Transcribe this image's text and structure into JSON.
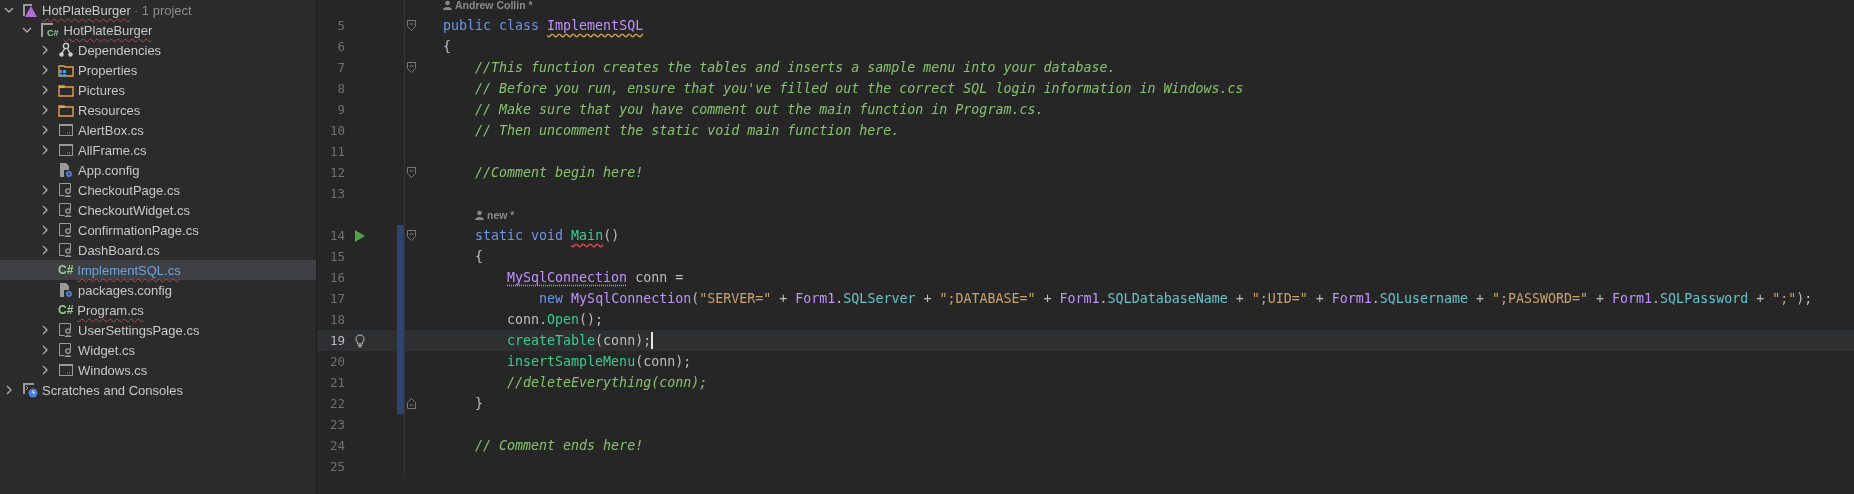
{
  "sidebar": {
    "items": [
      {
        "label": "HotPlateBurger",
        "note": "· 1 project",
        "kind": "solution",
        "squiggle": true,
        "expanded": true,
        "selected": false,
        "children": [
          {
            "label": "HotPlateBurger",
            "kind": "project",
            "badge": "C#",
            "squiggle": true,
            "expanded": true,
            "selected": false,
            "children": [
              {
                "label": "Dependencies",
                "kind": "dependencies",
                "squiggle": false,
                "expanded": false,
                "selected": false
              },
              {
                "label": "Properties",
                "kind": "properties",
                "squiggle": false,
                "expanded": false,
                "selected": false
              },
              {
                "label": "Pictures",
                "kind": "folder",
                "squiggle": false,
                "expanded": false,
                "selected": false
              },
              {
                "label": "Resources",
                "kind": "folder",
                "squiggle": false,
                "expanded": false,
                "selected": false
              },
              {
                "label": "AlertBox.cs",
                "kind": "form",
                "squiggle": false,
                "expanded": false,
                "selected": false
              },
              {
                "label": "AllFrame.cs",
                "kind": "form",
                "squiggle": false,
                "expanded": false,
                "selected": false
              },
              {
                "label": "App.config",
                "kind": "config",
                "leaf": true,
                "squiggle": false,
                "expanded": false,
                "selected": false
              },
              {
                "label": "CheckoutPage.cs",
                "kind": "usercontrol",
                "squiggle": false,
                "expanded": false,
                "selected": false
              },
              {
                "label": "CheckoutWidget.cs",
                "kind": "usercontrol",
                "squiggle": false,
                "expanded": false,
                "selected": false
              },
              {
                "label": "ConfirmationPage.cs",
                "kind": "usercontrol",
                "squiggle": false,
                "expanded": false,
                "selected": false
              },
              {
                "label": "DashBoard.cs",
                "kind": "usercontrol",
                "squiggle": false,
                "expanded": false,
                "selected": false
              },
              {
                "label": "ImplementSQL.cs",
                "kind": "csharp",
                "badge": "C#",
                "leaf": true,
                "squiggle": true,
                "expanded": false,
                "selected": true
              },
              {
                "label": "packages.config",
                "kind": "config",
                "leaf": true,
                "squiggle": false,
                "expanded": false,
                "selected": false
              },
              {
                "label": "Program.cs",
                "kind": "csharp",
                "badge": "C#",
                "leaf": true,
                "squiggle": true,
                "expanded": false,
                "selected": false
              },
              {
                "label": "UserSettingsPage.cs",
                "kind": "usercontrol",
                "squiggle": false,
                "expanded": false,
                "selected": false
              },
              {
                "label": "Widget.cs",
                "kind": "usercontrol",
                "squiggle": false,
                "expanded": false,
                "selected": false
              },
              {
                "label": "Windows.cs",
                "kind": "form",
                "squiggle": false,
                "expanded": false,
                "selected": false
              }
            ]
          }
        ]
      },
      {
        "label": "Scratches and Consoles",
        "kind": "scratches",
        "squiggle": false,
        "expanded": false,
        "selected": false
      }
    ]
  },
  "editor": {
    "lines": [
      {
        "kind": "hint",
        "text": "Andrew Collin *"
      },
      {
        "kind": "code",
        "number": "5",
        "fold": {
          "kind": "start"
        },
        "changed": false,
        "current": false,
        "tokens": [
          {
            "text": "public class ",
            "kind": "keyword"
          },
          {
            "text": "ImplementSQL",
            "kind": "type",
            "squiggle": {
              "kind": "warning"
            }
          }
        ]
      },
      {
        "kind": "code",
        "number": "6",
        "changed": false,
        "current": false,
        "tokens": [
          {
            "text": "{",
            "kind": "plain"
          }
        ]
      },
      {
        "kind": "code",
        "number": "7",
        "fold": {
          "kind": "start"
        },
        "changed": false,
        "current": false,
        "tokens": [
          {
            "text": "    //This function creates the tables and inserts a sample menu into your database.",
            "kind": "comment"
          }
        ]
      },
      {
        "kind": "code",
        "number": "8",
        "changed": false,
        "current": false,
        "tokens": [
          {
            "text": "    // Before you run, ensure that you've filled out the correct SQL login information in Windows.cs",
            "kind": "comment"
          }
        ]
      },
      {
        "kind": "code",
        "number": "9",
        "changed": false,
        "current": false,
        "tokens": [
          {
            "text": "    // Make sure that you have comment out the main function in Program.cs.",
            "kind": "comment"
          }
        ]
      },
      {
        "kind": "code",
        "number": "10",
        "changed": false,
        "current": false,
        "tokens": [
          {
            "text": "    // Then uncomment the static void main function here.",
            "kind": "comment"
          }
        ]
      },
      {
        "kind": "code",
        "number": "11",
        "changed": false,
        "current": false
      },
      {
        "kind": "code",
        "number": "12",
        "fold": {
          "kind": "start"
        },
        "changed": false,
        "current": false,
        "tokens": [
          {
            "text": "    //Comment begin here!",
            "kind": "comment"
          }
        ]
      },
      {
        "kind": "code",
        "number": "13",
        "changed": false,
        "current": false
      },
      {
        "kind": "hint",
        "text": "    new *"
      },
      {
        "kind": "code",
        "number": "14",
        "gutter": {
          "kind": "run"
        },
        "fold": {
          "kind": "start"
        },
        "changed": true,
        "current": false,
        "tokens": [
          {
            "text": "    static void ",
            "kind": "keyword"
          },
          {
            "text": "Main",
            "kind": "method",
            "squiggle": {
              "kind": "error"
            }
          },
          {
            "text": "()",
            "kind": "plain"
          }
        ]
      },
      {
        "kind": "code",
        "number": "15",
        "changed": true,
        "current": false,
        "tokens": [
          {
            "text": "    {",
            "kind": "plain"
          }
        ]
      },
      {
        "kind": "code",
        "number": "16",
        "changed": true,
        "current": false,
        "tokens": [
          {
            "text": "        MySqlConnection",
            "kind": "type",
            "squiggle": {
              "kind": "hint"
            }
          },
          {
            "text": " conn =",
            "kind": "plain"
          }
        ]
      },
      {
        "kind": "code",
        "number": "17",
        "changed": true,
        "current": false,
        "tokens": [
          {
            "text": "            new ",
            "kind": "keyword"
          },
          {
            "text": "MySqlConnection",
            "kind": "type"
          },
          {
            "text": "(",
            "kind": "plain"
          },
          {
            "text": "\"SERVER=\"",
            "kind": "string"
          },
          {
            "text": " + ",
            "kind": "plain"
          },
          {
            "text": "Form1",
            "kind": "type"
          },
          {
            "text": ".",
            "kind": "plain"
          },
          {
            "text": "SQLServer",
            "kind": "property"
          },
          {
            "text": " + ",
            "kind": "plain"
          },
          {
            "text": "\";DATABASE=\"",
            "kind": "string"
          },
          {
            "text": " + ",
            "kind": "plain"
          },
          {
            "text": "Form1",
            "kind": "type"
          },
          {
            "text": ".",
            "kind": "plain"
          },
          {
            "text": "SQLDatabaseName",
            "kind": "property"
          },
          {
            "text": " + ",
            "kind": "plain"
          },
          {
            "text": "\";UID=\"",
            "kind": "string"
          },
          {
            "text": " + ",
            "kind": "plain"
          },
          {
            "text": "Form1",
            "kind": "type"
          },
          {
            "text": ".",
            "kind": "plain"
          },
          {
            "text": "SQLusername",
            "kind": "property"
          },
          {
            "text": " + ",
            "kind": "plain"
          },
          {
            "text": "\";PASSWORD=\"",
            "kind": "string"
          },
          {
            "text": " + ",
            "kind": "plain"
          },
          {
            "text": "Form1",
            "kind": "type"
          },
          {
            "text": ".",
            "kind": "plain"
          },
          {
            "text": "SQLPassword",
            "kind": "property"
          },
          {
            "text": " + ",
            "kind": "plain"
          },
          {
            "text": "\";\"",
            "kind": "string"
          },
          {
            "text": ");",
            "kind": "plain"
          }
        ]
      },
      {
        "kind": "code",
        "number": "18",
        "changed": true,
        "current": false,
        "tokens": [
          {
            "text": "        conn.",
            "kind": "plain"
          },
          {
            "text": "Open",
            "kind": "method"
          },
          {
            "text": "();",
            "kind": "plain"
          }
        ]
      },
      {
        "kind": "code",
        "number": "19",
        "gutter": {
          "kind": "bulb"
        },
        "changed": true,
        "current": true,
        "cursor": true,
        "tokens": [
          {
            "text": "        createTable",
            "kind": "method"
          },
          {
            "text": "(conn);",
            "kind": "plain"
          }
        ]
      },
      {
        "kind": "code",
        "number": "20",
        "changed": true,
        "current": false,
        "tokens": [
          {
            "text": "        insertSampleMenu",
            "kind": "method"
          },
          {
            "text": "(conn);",
            "kind": "plain"
          }
        ]
      },
      {
        "kind": "code",
        "number": "21",
        "changed": true,
        "current": false,
        "tokens": [
          {
            "text": "        //deleteEverything(conn);",
            "kind": "comment"
          }
        ]
      },
      {
        "kind": "code",
        "number": "22",
        "fold": {
          "kind": "end"
        },
        "changed": true,
        "current": false,
        "tokens": [
          {
            "text": "    }",
            "kind": "plain"
          }
        ]
      },
      {
        "kind": "code",
        "number": "23",
        "changed": false,
        "current": false
      },
      {
        "kind": "code",
        "number": "24",
        "changed": false,
        "current": false,
        "tokens": [
          {
            "text": "    // Comment ends here!",
            "kind": "comment"
          }
        ]
      },
      {
        "kind": "code",
        "number": "25",
        "changed": false,
        "current": false
      }
    ]
  }
}
